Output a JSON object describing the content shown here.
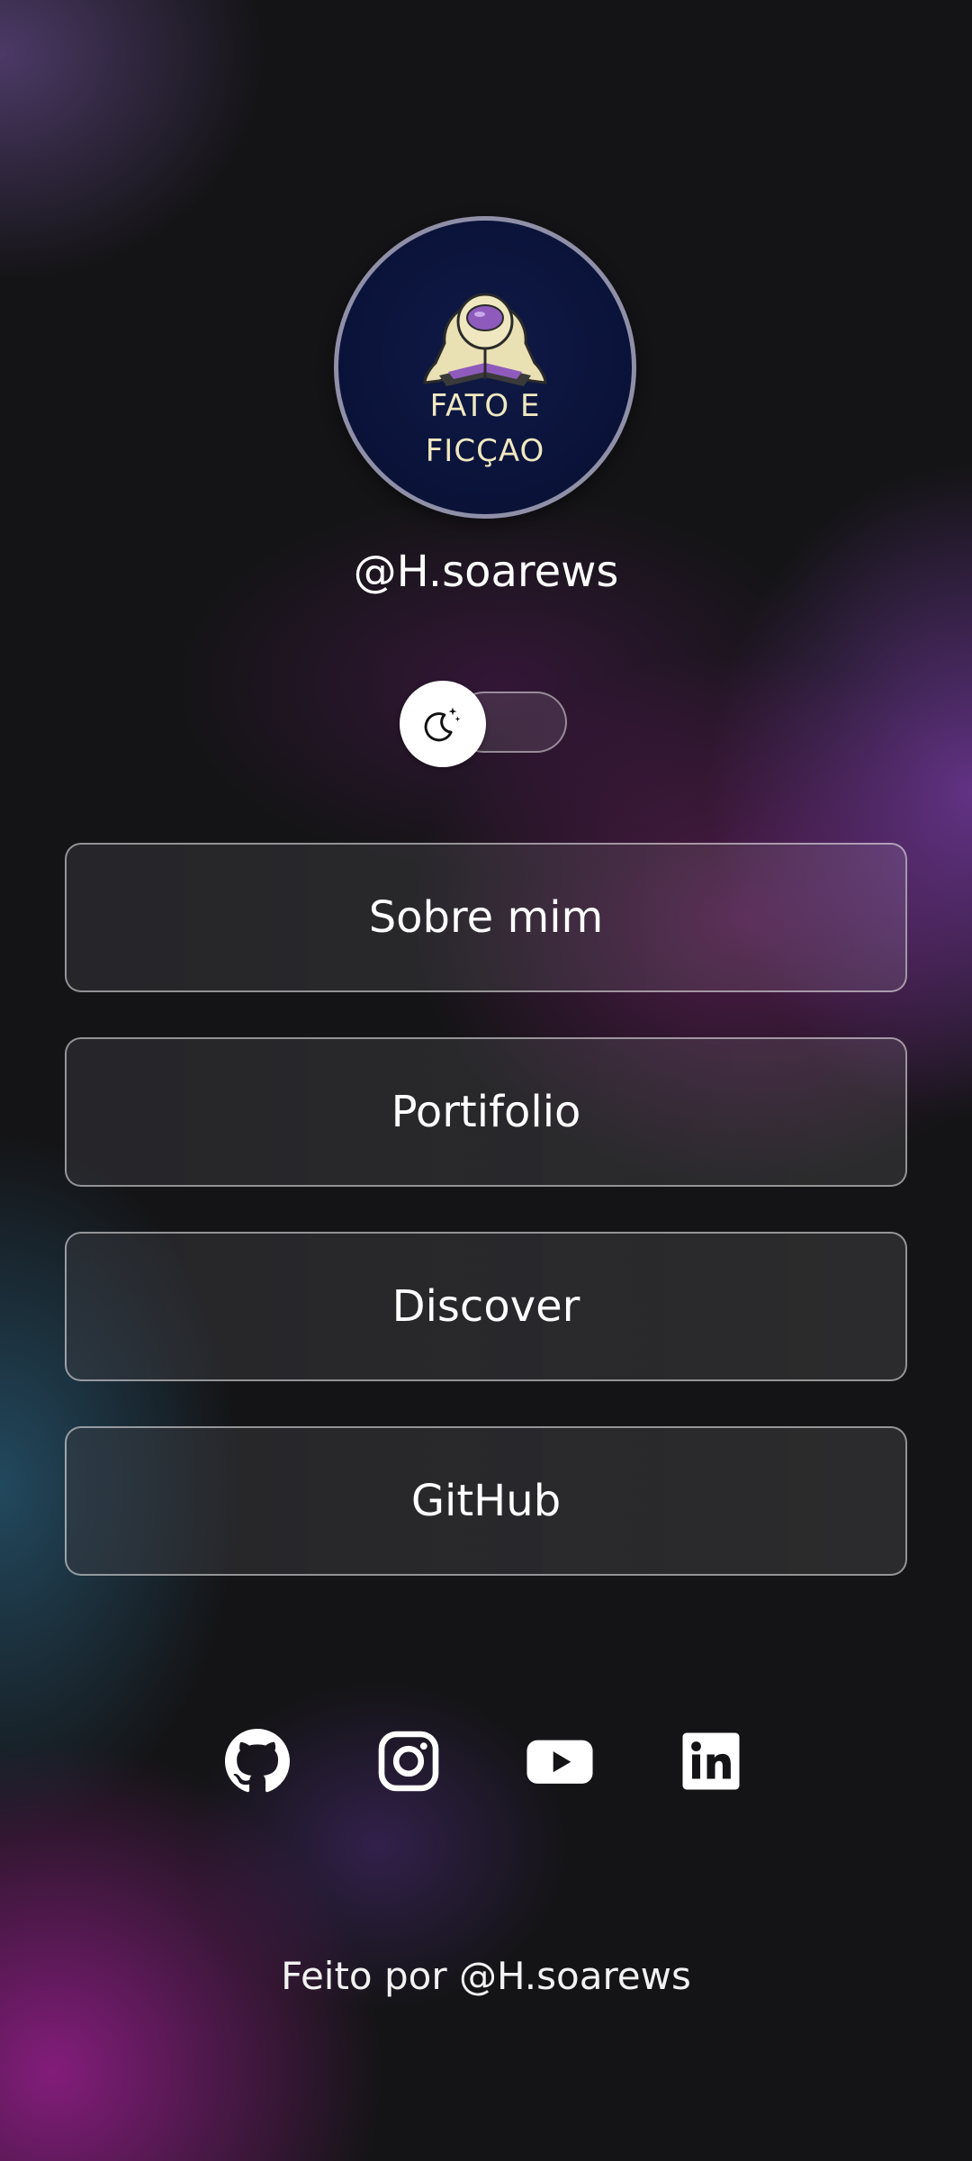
{
  "profile": {
    "logo_line1": "FATO E",
    "logo_line2": "FICÇAO",
    "handle": "@H.soarews"
  },
  "theme_toggle": {
    "icon": "moon-stars-icon",
    "state": "dark"
  },
  "links": [
    {
      "label": "Sobre mim"
    },
    {
      "label": "Portifolio"
    },
    {
      "label": "Discover"
    },
    {
      "label": "GitHub"
    }
  ],
  "social": [
    {
      "icon": "github-icon"
    },
    {
      "icon": "instagram-icon"
    },
    {
      "icon": "youtube-icon"
    },
    {
      "icon": "linkedin-icon"
    }
  ],
  "footer": {
    "text": "Feito por @H.soarews"
  },
  "colors": {
    "background": "#141416",
    "accent_purple": "#6e3796",
    "accent_magenta": "#961e8c",
    "accent_teal": "#285f7d",
    "logo_navy": "#0a1238",
    "logo_cream": "#f0e8c0"
  }
}
